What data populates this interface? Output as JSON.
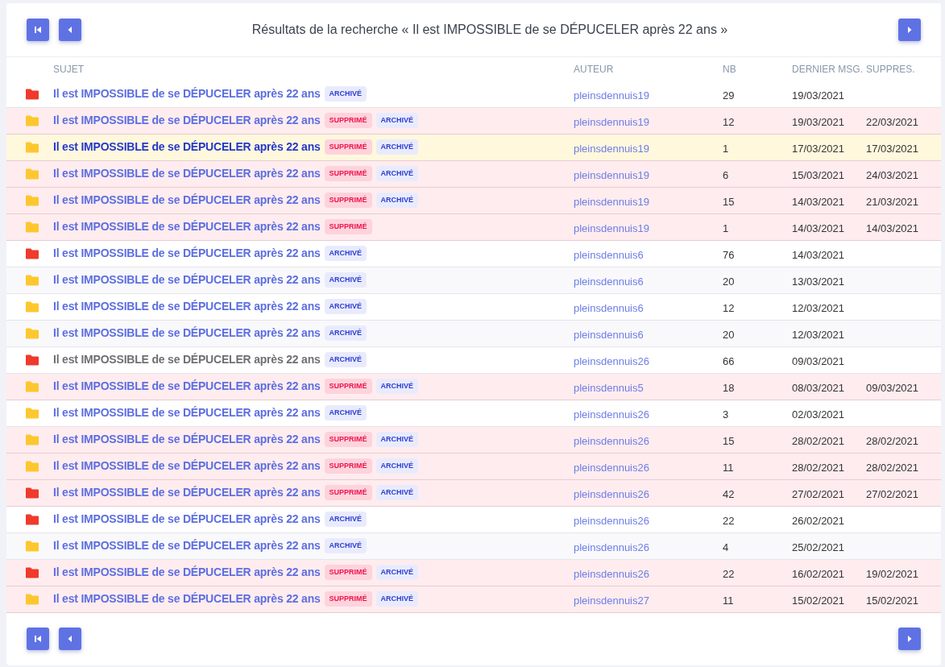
{
  "header": {
    "title": "Résultats de la recherche « Il est IMPOSSIBLE de se DÉPUCELER après 22 ans »"
  },
  "table": {
    "columns": [
      "SUJET",
      "AUTEUR",
      "NB",
      "DERNIER MSG.",
      "SUPPRES."
    ],
    "rows": [
      {
        "color": "#ef3a2c",
        "deleted": false,
        "highlighted": false,
        "visited": false,
        "subject": "Il est IMPOSSIBLE de se DÉPUCELER après 22 ans",
        "tags": [
          {
            "kind": "archived",
            "label": "ARCHIVÉ"
          }
        ],
        "author": "pleinsdennuis19",
        "count": "29",
        "last": "19/03/2021"
      },
      {
        "color": "#fdc72f",
        "deleted": true,
        "highlighted": false,
        "visited": false,
        "subject": "Il est IMPOSSIBLE de se DÉPUCELER après 22 ans",
        "tags": [
          {
            "kind": "deleted",
            "label": "SUPPRIMÉ"
          },
          {
            "kind": "archived",
            "label": "ARCHIVÉ"
          }
        ],
        "author": "pleinsdennuis19",
        "count": "12",
        "last": "19/03/2021",
        "deleted_on": "22/03/2021"
      },
      {
        "color": "#fdc72f",
        "deleted": true,
        "highlighted": true,
        "visited": false,
        "subject": "Il est IMPOSSIBLE de se DÉPUCELER après 22 ans",
        "tags": [
          {
            "kind": "deleted",
            "label": "SUPPRIMÉ"
          },
          {
            "kind": "archived",
            "label": "ARCHIVÉ"
          }
        ],
        "author": "pleinsdennuis19",
        "count": "1",
        "last": "17/03/2021",
        "deleted_on": "17/03/2021"
      },
      {
        "color": "#fdc72f",
        "deleted": true,
        "highlighted": false,
        "visited": false,
        "subject": "Il est IMPOSSIBLE de se DÉPUCELER après 22 ans",
        "tags": [
          {
            "kind": "deleted",
            "label": "SUPPRIMÉ"
          },
          {
            "kind": "archived",
            "label": "ARCHIVÉ"
          }
        ],
        "author": "pleinsdennuis19",
        "count": "6",
        "last": "15/03/2021",
        "deleted_on": "24/03/2021"
      },
      {
        "color": "#fdc72f",
        "deleted": true,
        "highlighted": false,
        "visited": false,
        "subject": "Il est IMPOSSIBLE de se DÉPUCELER après 22 ans",
        "tags": [
          {
            "kind": "deleted",
            "label": "SUPPRIMÉ"
          },
          {
            "kind": "archived",
            "label": "ARCHIVÉ"
          }
        ],
        "author": "pleinsdennuis19",
        "count": "15",
        "last": "14/03/2021",
        "deleted_on": "21/03/2021"
      },
      {
        "color": "#fdc72f",
        "deleted": true,
        "highlighted": false,
        "visited": false,
        "subject": "Il est IMPOSSIBLE de se DÉPUCELER après 22 ans",
        "tags": [
          {
            "kind": "deleted",
            "label": "SUPPRIMÉ"
          }
        ],
        "author": "pleinsdennuis19",
        "count": "1",
        "last": "14/03/2021",
        "deleted_on": "14/03/2021"
      },
      {
        "color": "#ef3a2c",
        "deleted": false,
        "highlighted": false,
        "visited": false,
        "subject": "Il est IMPOSSIBLE de se DÉPUCELER après 22 ans",
        "tags": [
          {
            "kind": "archived",
            "label": "ARCHIVÉ"
          }
        ],
        "author": "pleinsdennuis6",
        "count": "76",
        "last": "14/03/2021"
      },
      {
        "color": "#fdc72f",
        "deleted": false,
        "highlighted": false,
        "visited": false,
        "subject": "Il est IMPOSSIBLE de se DÉPUCELER après 22 ans",
        "tags": [
          {
            "kind": "archived",
            "label": "ARCHIVÉ"
          }
        ],
        "author": "pleinsdennuis6",
        "count": "20",
        "last": "13/03/2021"
      },
      {
        "color": "#fdc72f",
        "deleted": false,
        "highlighted": false,
        "visited": false,
        "subject": "Il est IMPOSSIBLE de se DÉPUCELER après 22 ans",
        "tags": [
          {
            "kind": "archived",
            "label": "ARCHIVÉ"
          }
        ],
        "author": "pleinsdennuis6",
        "count": "12",
        "last": "12/03/2021"
      },
      {
        "color": "#fdc72f",
        "deleted": false,
        "highlighted": false,
        "visited": false,
        "subject": "Il est IMPOSSIBLE de se DÉPUCELER après 22 ans",
        "tags": [
          {
            "kind": "archived",
            "label": "ARCHIVÉ"
          }
        ],
        "author": "pleinsdennuis6",
        "count": "20",
        "last": "12/03/2021"
      },
      {
        "color": "#ef3a2c",
        "deleted": false,
        "highlighted": false,
        "visited": true,
        "subject": "Il est IMPOSSIBLE de se DÉPUCELER après 22 ans",
        "tags": [
          {
            "kind": "archived",
            "label": "ARCHIVÉ"
          }
        ],
        "author": "pleinsdennuis26",
        "count": "66",
        "last": "09/03/2021"
      },
      {
        "color": "#fdc72f",
        "deleted": true,
        "highlighted": false,
        "visited": false,
        "subject": "Il est IMPOSSIBLE de se DÉPUCELER après 22 ans",
        "tags": [
          {
            "kind": "deleted",
            "label": "SUPPRIMÉ"
          },
          {
            "kind": "archived",
            "label": "ARCHIVÉ"
          }
        ],
        "author": "pleinsdennuis5",
        "count": "18",
        "last": "08/03/2021",
        "deleted_on": "09/03/2021"
      },
      {
        "color": "#fdc72f",
        "deleted": false,
        "highlighted": false,
        "visited": false,
        "subject": "Il est IMPOSSIBLE de se DÉPUCELER après 22 ans",
        "tags": [
          {
            "kind": "archived",
            "label": "ARCHIVÉ"
          }
        ],
        "author": "pleinsdennuis26",
        "count": "3",
        "last": "02/03/2021"
      },
      {
        "color": "#fdc72f",
        "deleted": true,
        "highlighted": false,
        "visited": false,
        "subject": "Il est IMPOSSIBLE de se DÉPUCELER après 22 ans",
        "tags": [
          {
            "kind": "deleted",
            "label": "SUPPRIMÉ"
          },
          {
            "kind": "archived",
            "label": "ARCHIVÉ"
          }
        ],
        "author": "pleinsdennuis26",
        "count": "15",
        "last": "28/02/2021",
        "deleted_on": "28/02/2021"
      },
      {
        "color": "#fdc72f",
        "deleted": true,
        "highlighted": false,
        "visited": false,
        "subject": "Il est IMPOSSIBLE de se DÉPUCELER après 22 ans",
        "tags": [
          {
            "kind": "deleted",
            "label": "SUPPRIMÉ"
          },
          {
            "kind": "archived",
            "label": "ARCHIVÉ"
          }
        ],
        "author": "pleinsdennuis26",
        "count": "11",
        "last": "28/02/2021",
        "deleted_on": "28/02/2021"
      },
      {
        "color": "#ef3a2c",
        "deleted": true,
        "highlighted": false,
        "visited": false,
        "subject": "Il est IMPOSSIBLE de se DÉPUCELER après 22 ans",
        "tags": [
          {
            "kind": "deleted",
            "label": "SUPPRIMÉ"
          },
          {
            "kind": "archived",
            "label": "ARCHIVÉ"
          }
        ],
        "author": "pleinsdennuis26",
        "count": "42",
        "last": "27/02/2021",
        "deleted_on": "27/02/2021"
      },
      {
        "color": "#ef3a2c",
        "deleted": false,
        "highlighted": false,
        "visited": false,
        "subject": "Il est IMPOSSIBLE de se DÉPUCELER après 22 ans",
        "tags": [
          {
            "kind": "archived",
            "label": "ARCHIVÉ"
          }
        ],
        "author": "pleinsdennuis26",
        "count": "22",
        "last": "26/02/2021"
      },
      {
        "color": "#fdc72f",
        "deleted": false,
        "highlighted": false,
        "visited": false,
        "subject": "Il est IMPOSSIBLE de se DÉPUCELER après 22 ans",
        "tags": [
          {
            "kind": "archived",
            "label": "ARCHIVÉ"
          }
        ],
        "author": "pleinsdennuis26",
        "count": "4",
        "last": "25/02/2021"
      },
      {
        "color": "#ef3a2c",
        "deleted": true,
        "highlighted": false,
        "visited": false,
        "subject": "Il est IMPOSSIBLE de se DÉPUCELER après 22 ans",
        "tags": [
          {
            "kind": "deleted",
            "label": "SUPPRIMÉ"
          },
          {
            "kind": "archived",
            "label": "ARCHIVÉ"
          }
        ],
        "author": "pleinsdennuis26",
        "count": "22",
        "last": "16/02/2021",
        "deleted_on": "19/02/2021"
      },
      {
        "color": "#fdc72f",
        "deleted": true,
        "highlighted": false,
        "visited": false,
        "subject": "Il est IMPOSSIBLE de se DÉPUCELER après 22 ans",
        "tags": [
          {
            "kind": "deleted",
            "label": "SUPPRIMÉ"
          },
          {
            "kind": "archived",
            "label": "ARCHIVÉ"
          }
        ],
        "author": "pleinsdennuis27",
        "count": "11",
        "last": "15/02/2021",
        "deleted_on": "15/02/2021"
      }
    ]
  }
}
